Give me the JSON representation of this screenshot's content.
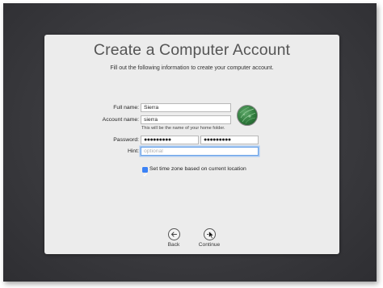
{
  "window": {
    "title": "Create a Computer Account",
    "subtitle": "Fill out the following information to create your computer account."
  },
  "form": {
    "full_name": {
      "label": "Full name:",
      "value": "Sierra"
    },
    "account_name": {
      "label": "Account name:",
      "value": "sierra",
      "hint": "This will be the name of your home folder."
    },
    "password": {
      "label": "Password:",
      "value": "●●●●●●●●●",
      "verify_value": "●●●●●●●●●"
    },
    "hint": {
      "label": "Hint:",
      "placeholder": "optional",
      "value": ""
    },
    "avatar": {
      "icon": "user-picture-icon"
    },
    "timezone_checkbox": {
      "label": "Set time zone based on current location",
      "checked": true
    }
  },
  "navigation": {
    "back_label": "Back",
    "continue_label": "Continue"
  },
  "colors": {
    "accent": "#3b82f6",
    "panel": "#ececec",
    "background": "#3a3a3e"
  }
}
